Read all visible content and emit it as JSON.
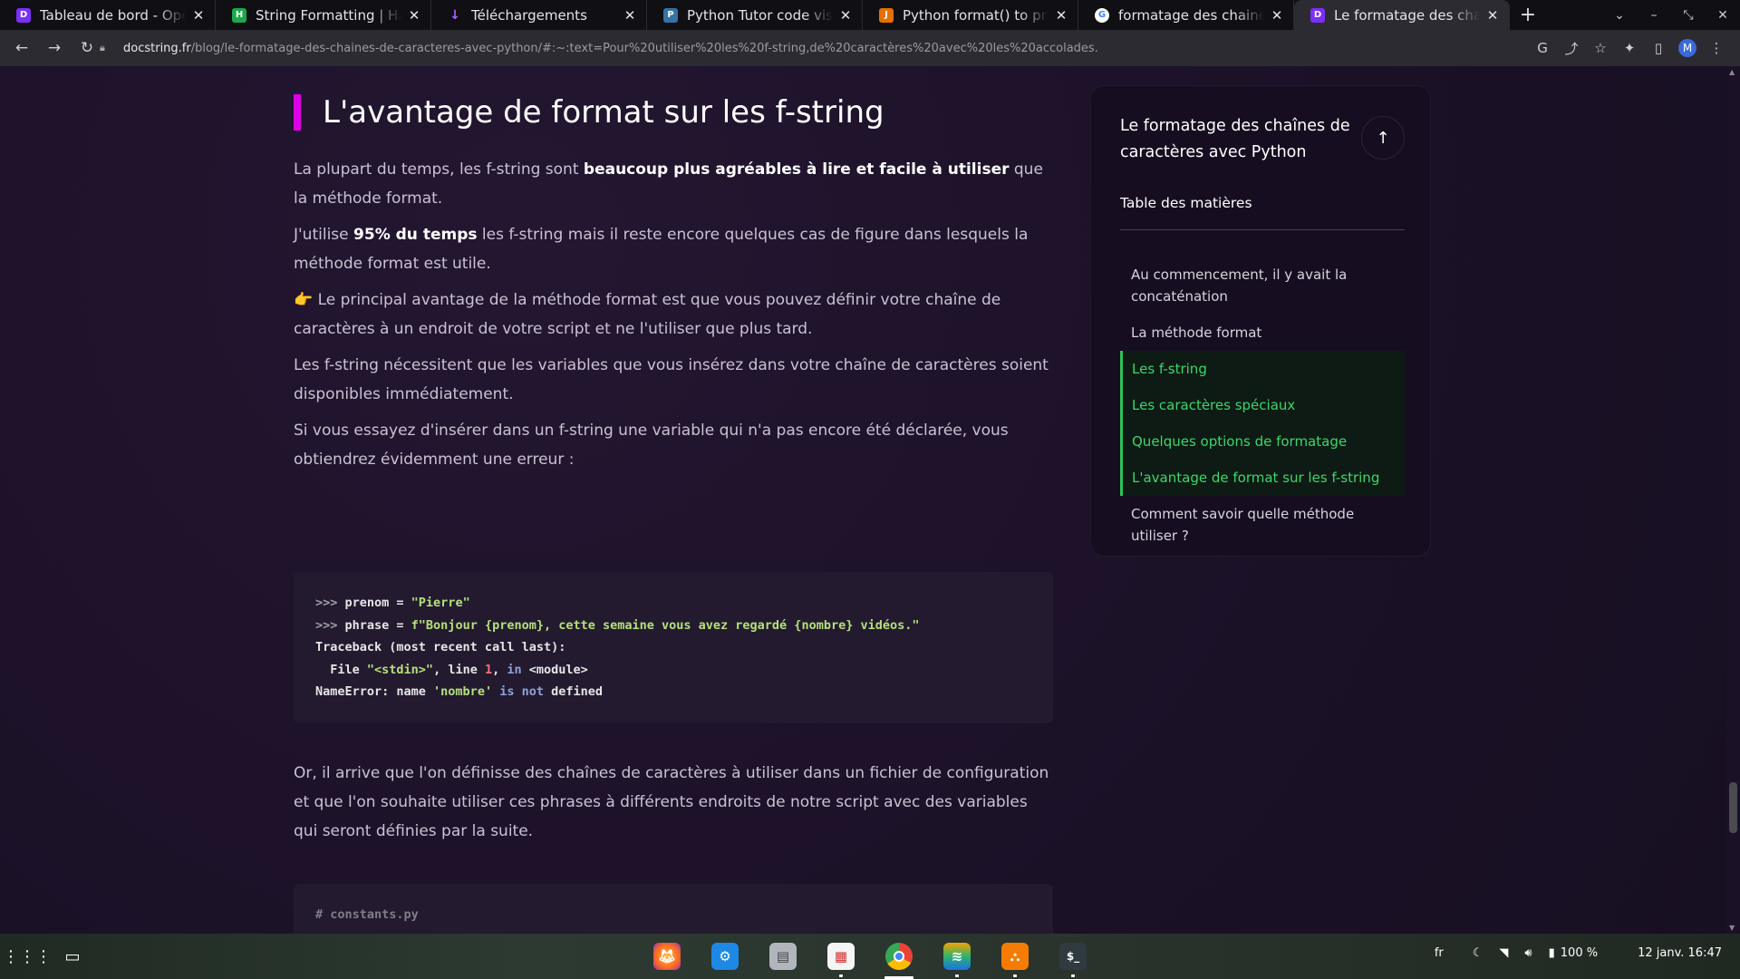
{
  "tabs": [
    {
      "title": "Tableau de bord - OpenClassrooms",
      "favicon": "D",
      "favicon_color": "#7b2ff7"
    },
    {
      "title": "String Formatting | HackerRank",
      "favicon": "H",
      "favicon_color": "#1ba94c"
    },
    {
      "title": "Téléchargements",
      "favicon": "↓",
      "favicon_color": "#8e44ff"
    },
    {
      "title": "Python Tutor code visualizer",
      "favicon": "P",
      "favicon_color": "#3572a5"
    },
    {
      "title": "Python format() to print",
      "favicon": "J",
      "favicon_color": "#e76f00"
    },
    {
      "title": "formatage des chaines de caractères",
      "favicon": "G",
      "favicon_color": "#ffffff"
    },
    {
      "title": "Le formatage des chaînes",
      "favicon": "D",
      "favicon_color": "#7b2ff7",
      "active": true
    }
  ],
  "address": {
    "host": "docstring.fr",
    "path": "/blog/le-formatage-des-chaines-de-caracteres-avec-python/#:~:text=Pour%20utiliser%20les%20f-string,de%20caractères%20avec%20les%20accolades."
  },
  "profile_initial": "M",
  "article": {
    "heading": "L'avantage de format sur les f-string",
    "p1_a": "La plupart du temps, les f-string sont ",
    "p1_b": "beaucoup plus agréables à lire et facile à utiliser",
    "p1_c": " que la méthode format.",
    "p2_a": "J'utilise ",
    "p2_b": "95% du temps",
    "p2_c": " les f-string mais il reste encore quelques cas de figure dans lesquels la méthode format est utile.",
    "p3": "👉 Le principal avantage de la méthode format est que vous pouvez définir votre chaîne de caractères à un endroit de votre script et ne l'utiliser que plus tard.",
    "p4": "Les f-string nécessitent que les variables que vous insérez dans votre chaîne de caractères soient disponibles immédiatement.",
    "p5": "Si vous essayez d'insérer dans un f-string une variable qui n'a pas encore été déclarée, vous obtiendrez évidemment une erreur :",
    "p6": "Or, il arrive que l'on définisse des chaînes de caractères à utiliser dans un fichier de configuration et que l'on souhaite utiliser ces phrases à différents endroits de notre script avec des variables qui seront définies par la suite.",
    "code1": {
      "l1_prompt": ">>> ",
      "l1_code": "prenom = ",
      "l1_str": "\"Pierre\"",
      "l2_prompt": ">>> ",
      "l2_code": "phrase = ",
      "l2_str": "f\"Bonjour {prenom}, cette semaine vous avez regardé {nombre} vidéos.\"",
      "l3": "Traceback (most recent call last):",
      "l4_a": "  File ",
      "l4_str": "\"<stdin>\"",
      "l4_b": ", line ",
      "l4_num": "1",
      "l4_c": ", ",
      "l4_kw": "in",
      "l4_d": " <module>",
      "l5_a": "NameError: name ",
      "l5_str": "'nombre'",
      "l5_b": " ",
      "l5_kw1": "is",
      "l5_c": " ",
      "l5_kw2": "not",
      "l5_d": " defined"
    },
    "code2": {
      "comment": "# constants.py"
    }
  },
  "toc": {
    "title": "Le formatage des chaînes de caractères avec Python",
    "subtitle": "Table des matières",
    "items": [
      {
        "label": "Au commencement, il y avait la concaténation",
        "active": false
      },
      {
        "label": "La méthode format",
        "active": false
      },
      {
        "label": "Les f-string",
        "active": true
      },
      {
        "label": "Les caractères spéciaux",
        "active": true
      },
      {
        "label": "Quelques options de formatage",
        "active": true
      },
      {
        "label": "L'avantage de format sur les f-string",
        "active": true
      },
      {
        "label": "Comment savoir quelle méthode utiliser ?",
        "active": false
      }
    ]
  },
  "taskbar": {
    "apps": [
      "firefox-icon",
      "store-icon",
      "files-icon",
      "document-viewer-icon",
      "chrome-icon",
      "layers-icon",
      "network-icon",
      "terminal-icon"
    ],
    "lang": "fr",
    "battery": "100 %",
    "datetime": "12 janv. 16:47"
  }
}
